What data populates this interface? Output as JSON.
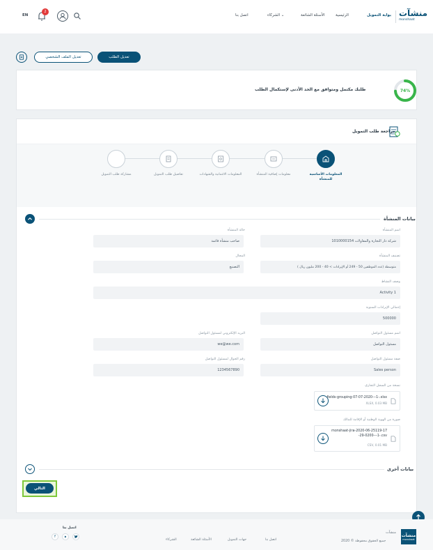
{
  "header": {
    "lang": "EN",
    "notif_count": "2",
    "nav": {
      "contact": "اتصل بنا",
      "partners": "الشركاء",
      "faq": "الأسئلة الشائعة",
      "home": "الرئيسية",
      "portal": "بوابة التمويل"
    },
    "logo_ar": "منشآت",
    "logo_en": "monshaat"
  },
  "actions": {
    "edit_request": "تعديل الطلب",
    "edit_profile": "تعديل الملف الشخصي"
  },
  "progress": {
    "value": 74,
    "label": "74%",
    "message": "طلبك مكتمل ومتوافق مع الحد الأدنى لإستكمال الطلب"
  },
  "review": {
    "title": "مراجعة طلب التمويل",
    "steps": [
      {
        "label": "المعلومات الأساسية للمنشأة",
        "active": true
      },
      {
        "label": "معلومات إضافية المنشأة",
        "active": false
      },
      {
        "label": "المعلومات الائتمانية والشهادات",
        "active": false
      },
      {
        "label": "تفاصيل طلب التمويل",
        "active": false
      },
      {
        "label": "مشاركة طلب التمويل",
        "active": false
      }
    ]
  },
  "section": {
    "title": "بيانات المنشأة",
    "fields": {
      "company_name_label": "اسم المنشأة",
      "company_name_value": "شركة دار التجارة والمقاولات 1010000154",
      "status_label": "حالة المنشأة",
      "status_value": "صاحب منشأة قائمة",
      "classification_label": "تصنيف المنشأة",
      "classification_value": "متوسطة (عدد الموظفين 50 - 249 أو الإيرادات > 40 - 200 مليون ريال )",
      "sector_label": "المجال",
      "sector_value": "التصنيع",
      "activity_label": "وصف النشاط",
      "activity_value": "Activity 1",
      "revenue_label": "إجمالي الإيرادات السنوية",
      "revenue_value": "500000",
      "contact_name_label": "اسم مسئول التواصل",
      "contact_name_value": "مسئول التواصل",
      "email_label": "البريد الإلكتروني لمسئول التواصل",
      "email_value": "we@we.com",
      "contact_role_label": "صفة مسئول التواصل",
      "contact_role_value": "Sales person",
      "mobile_label": "رقم الجوال لمسئول التواصل",
      "mobile_value": "1234567890",
      "cr_copy_label": "نسخة من السجل التجاري",
      "id_copy_label": "صورة من الهوية الوطنية أو الإقامة للمالك"
    },
    "files": [
      {
        "name": "fields-grouping-07-07-2020---1-.xlsx",
        "meta": "XLSX, 0.03 MB"
      },
      {
        "name": "monshaat-jira-2020-06-25119-17-29-0200---1-.csv",
        "meta": "CSV, 0.01 MB"
      }
    ]
  },
  "other_section": {
    "title": "بيانات أخرى"
  },
  "next_button": "التالي",
  "footer": {
    "contact_title": "اتصل بنا",
    "links": [
      "اتصل بنا",
      "جهات التمويل",
      "الأسئلة الشائعة",
      "الشركاء"
    ],
    "copyright": "جميع الحقوق محفوظة © 2020",
    "logo_ar": "منشآت",
    "logo_en": "monshaat"
  },
  "colors": {
    "primary": "#0a5277",
    "green": "#39b54a",
    "highlight": "#7ec83a"
  }
}
